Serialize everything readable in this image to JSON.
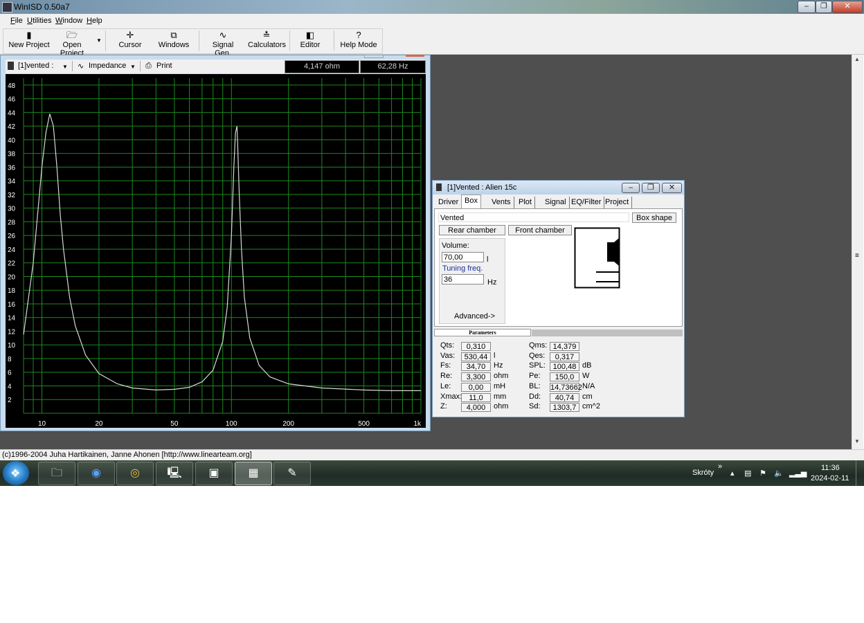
{
  "window": {
    "title": "WinISD 0.50a7"
  },
  "menu": [
    {
      "label": "File"
    },
    {
      "label": "Utilities"
    },
    {
      "label": "Window"
    },
    {
      "label": "Help"
    }
  ],
  "toolbar": {
    "new_project": "New Project",
    "open_project": "Open Project",
    "cursor": "Cursor",
    "windows": "Windows",
    "signal_gen": "Signal Gen.",
    "calculators": "Calculators",
    "editor": "Editor",
    "help_mode": "Help Mode"
  },
  "graph": {
    "project_select": "[1]vented :",
    "plot_select": "Impedance",
    "print": "Print",
    "readout_value": "4,147 ohm",
    "readout_freq": "62,28 Hz",
    "colors": {
      "background": "#000000",
      "grid": "#1c8a1c",
      "curve": "#d8d8d8",
      "labels": "#ffffff"
    }
  },
  "chart_data": {
    "type": "line",
    "xscale": "log",
    "xlim": [
      8,
      1000
    ],
    "ylim": [
      0,
      49
    ],
    "y_ticks": [
      2,
      4,
      6,
      8,
      10,
      12,
      14,
      16,
      18,
      20,
      22,
      24,
      26,
      28,
      30,
      32,
      34,
      36,
      38,
      40,
      42,
      44,
      46,
      48
    ],
    "x_tick_labels": [
      {
        "x": 10,
        "label": "10"
      },
      {
        "x": 20,
        "label": "20"
      },
      {
        "x": 50,
        "label": "50"
      },
      {
        "x": 100,
        "label": "100"
      },
      {
        "x": 200,
        "label": "200"
      },
      {
        "x": 500,
        "label": "500"
      },
      {
        "x": 1000,
        "label": "1k"
      }
    ],
    "series": [
      {
        "x": [
          8,
          9,
          10,
          10.5,
          11,
          11.5,
          12,
          12.5,
          13,
          14,
          15,
          17,
          20,
          25,
          30,
          40,
          50,
          60,
          70,
          80,
          90,
          95,
          100,
          103,
          105,
          107,
          108,
          110,
          113,
          117,
          125,
          140,
          160,
          200,
          300,
          500,
          700,
          1000
        ],
        "y": [
          11.5,
          22,
          36,
          41,
          43.8,
          42,
          36,
          29,
          24,
          17,
          12.8,
          8.5,
          5.8,
          4.3,
          3.7,
          3.4,
          3.5,
          3.8,
          4.6,
          6.3,
          10.5,
          15.5,
          26,
          36,
          41,
          42,
          39,
          32,
          24,
          17,
          11,
          7,
          5.3,
          4.3,
          3.7,
          3.4,
          3.3,
          3.3
        ]
      }
    ]
  },
  "params_window": {
    "title": "[1]Vented : Alien 15c",
    "tabs": [
      "Driver",
      "Box",
      "Vents",
      "Plot",
      "Signal",
      "EQ/Filter",
      "Project"
    ],
    "active_tab": "Box",
    "box_type": "Vented",
    "box_shape_btn": "Box shape",
    "rear_chamber_btn": "Rear chamber",
    "front_chamber_btn": "Front chamber",
    "volume_label": "Volume:",
    "volume_value": "70,00",
    "volume_unit": "l",
    "tuning_label": "Tuning freq.",
    "tuning_value": "36",
    "tuning_unit": "Hz",
    "advanced": "Advanced->",
    "parameters_header": "Parameters",
    "params_left": [
      {
        "label": "Qts:",
        "value": "0,310",
        "unit": ""
      },
      {
        "label": "Vas:",
        "value": "530,44",
        "unit": "l"
      },
      {
        "label": "Fs:",
        "value": "34,70",
        "unit": "Hz"
      },
      {
        "label": "Re:",
        "value": "3,300",
        "unit": "ohm"
      },
      {
        "label": "Le:",
        "value": "0,00",
        "unit": "mH"
      },
      {
        "label": "Xmax:",
        "value": "11,0",
        "unit": "mm"
      },
      {
        "label": "Z:",
        "value": "4,000",
        "unit": "ohm"
      }
    ],
    "params_right": [
      {
        "label": "Qms:",
        "value": "14,379",
        "unit": ""
      },
      {
        "label": "Qes:",
        "value": "0,317",
        "unit": ""
      },
      {
        "label": "SPL:",
        "value": "100,48",
        "unit": "dB"
      },
      {
        "label": "Pe:",
        "value": "150,0",
        "unit": "W"
      },
      {
        "label": "BL:",
        "value": "14,73662",
        "unit": "N/A"
      },
      {
        "label": "Dd:",
        "value": "40,74",
        "unit": "cm"
      },
      {
        "label": "Sd:",
        "value": "1303,7",
        "unit": "cm^2"
      }
    ]
  },
  "status_bar": {
    "text": "(c)1996-2004 Juha Hartikainen, Janne Ahonen [http://www.linearteam.org]"
  },
  "taskbar": {
    "apps": [
      "explorer-icon",
      "chromium-icon",
      "chrome-icon",
      "remote-desktop-icon",
      "photo-viewer-icon",
      "winisd-icon",
      "paint-icon"
    ],
    "shortcuts_label": "Skróty",
    "time": "11:36",
    "date": "2024-02-11"
  }
}
